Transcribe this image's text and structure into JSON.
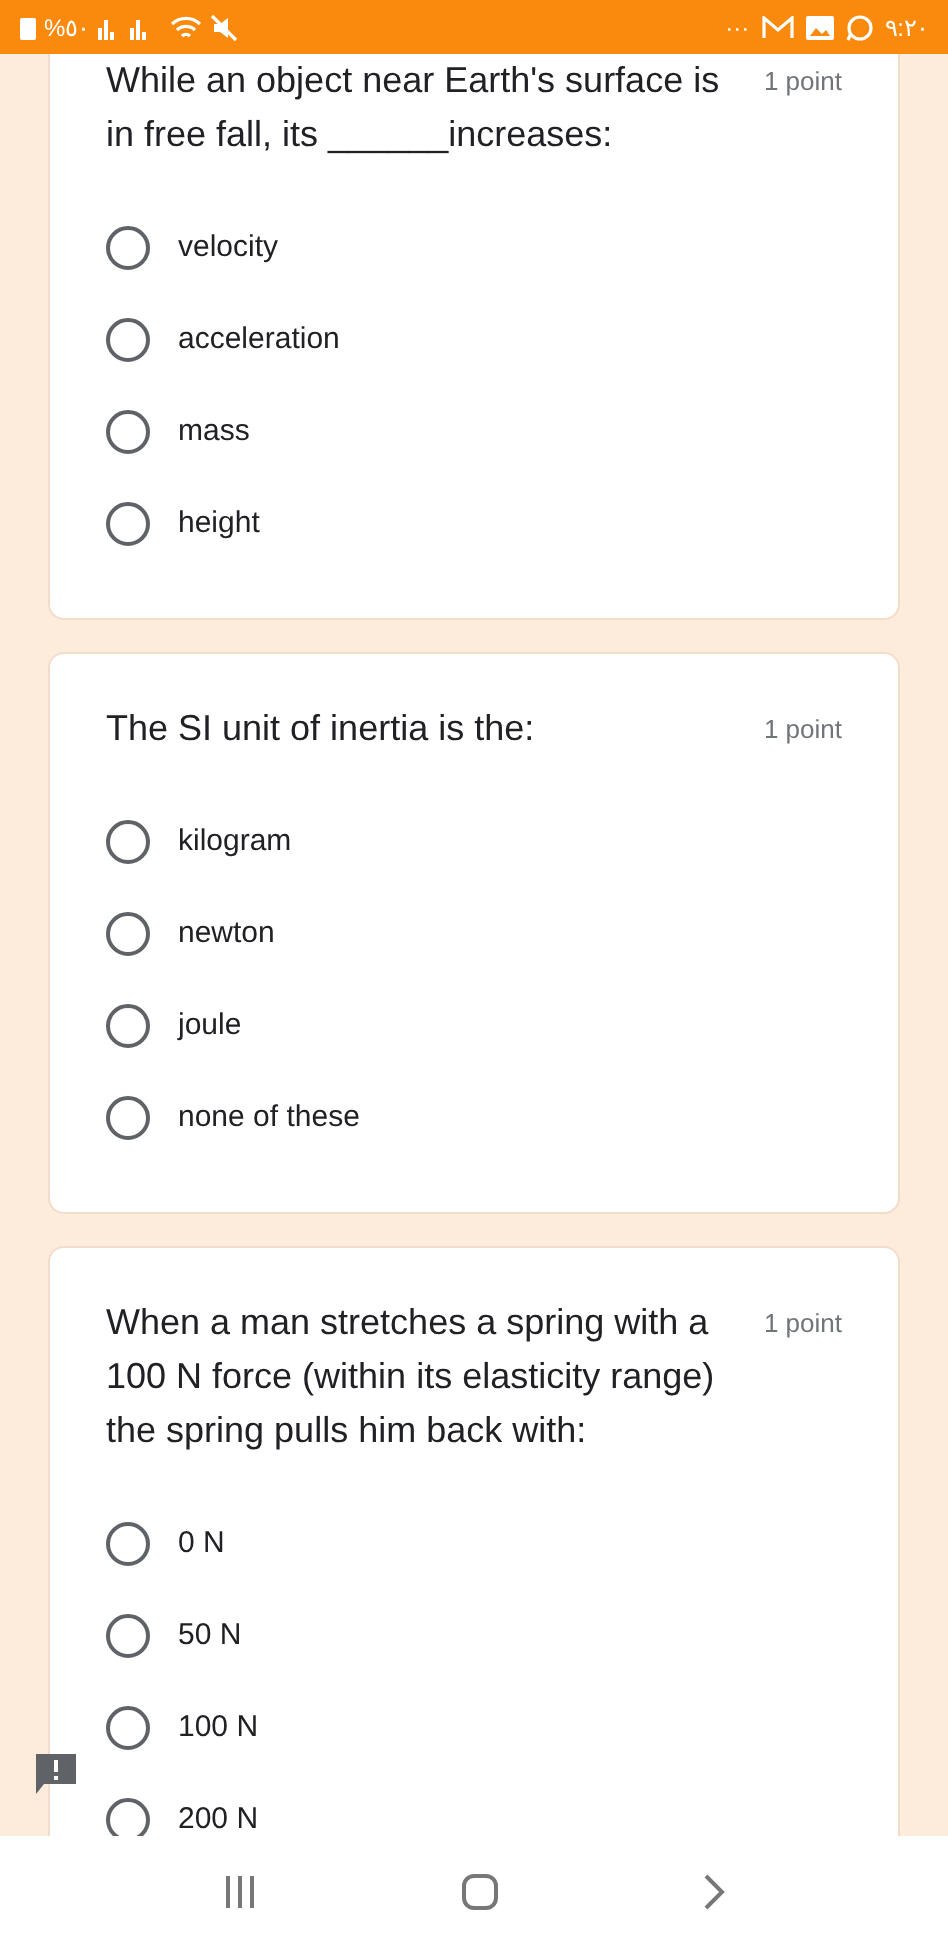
{
  "status_bar": {
    "battery": "%٥٠",
    "more": "···",
    "time": "٩:٢٠"
  },
  "questions": [
    {
      "text": "While an object near Earth's surface is in free fall, its ______increases:",
      "points": "1 point",
      "options": [
        {
          "label": "velocity",
          "selected": false
        },
        {
          "label": "acceleration",
          "selected": false
        },
        {
          "label": "mass",
          "selected": false
        },
        {
          "label": "height",
          "selected": false
        }
      ]
    },
    {
      "text": "The SI unit of inertia is the:",
      "points": "1 point",
      "options": [
        {
          "label": "kilogram",
          "selected": false
        },
        {
          "label": "newton",
          "selected": false
        },
        {
          "label": "joule",
          "selected": false
        },
        {
          "label": "none of these",
          "selected": false
        }
      ]
    },
    {
      "text": "When a man stretches a spring with a 100 N force (within its elasticity range) the spring pulls him back with:",
      "points": "1 point",
      "options": [
        {
          "label": "0 N",
          "selected": false
        },
        {
          "label": "50 N",
          "selected": false
        },
        {
          "label": "100 N",
          "selected": false
        },
        {
          "label": "200 N",
          "selected": false
        }
      ]
    }
  ]
}
